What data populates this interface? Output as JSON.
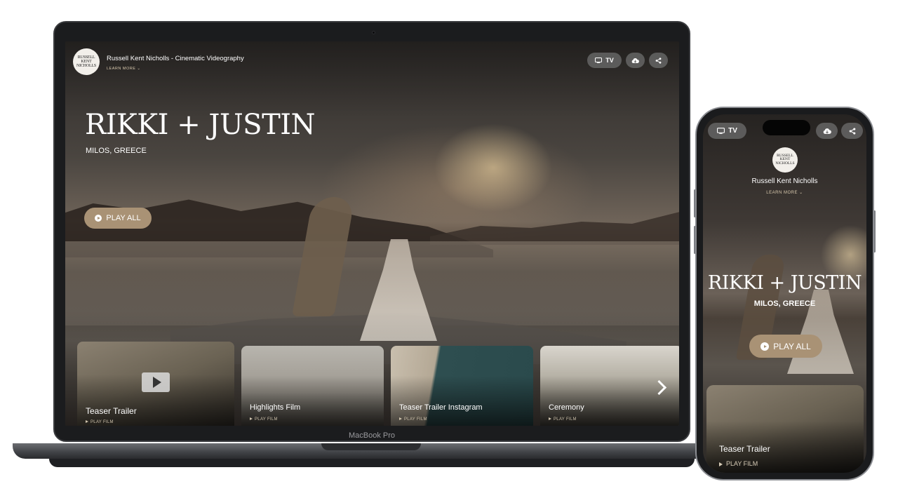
{
  "colors": {
    "accent": "#a99275",
    "learn_more": "#d8c9ad",
    "pill_bg": "rgba(110,110,110,0.75)",
    "device_frame": "#1b1c1e"
  },
  "laptop": {
    "device_label": "MacBook Pro",
    "header": {
      "logo_text": "RUSSELL\nKENT\nNICHOLLS",
      "brand_name": "Russell Kent Nicholls - Cinematic Videography",
      "learn_more": "LEARN MORE"
    },
    "top_buttons": {
      "tv_label": "TV",
      "tv_icon": "tv-icon",
      "download_icon": "cloud-download-icon",
      "share_icon": "share-icon"
    },
    "hero": {
      "title": "RIKKI + JUSTIN",
      "location": "MILOS, GREECE",
      "play_all_label": "PLAY ALL"
    },
    "films": [
      {
        "title": "Teaser Trailer",
        "action": "PLAY FILM"
      },
      {
        "title": "Highlights Film",
        "action": "PLAY FILM"
      },
      {
        "title": "Teaser Trailer Instagram",
        "action": "PLAY FILM"
      },
      {
        "title": "Ceremony",
        "action": "PLAY FILM"
      }
    ],
    "next_icon": "chevron-right-icon"
  },
  "phone": {
    "top_buttons": {
      "tv_label": "TV",
      "tv_icon": "tv-icon",
      "download_icon": "cloud-download-icon",
      "share_icon": "share-icon"
    },
    "header": {
      "logo_text": "RUSSELL\nKENT\nNICHOLLS",
      "brand_name": "Russell Kent Nicholls",
      "learn_more": "LEARN MORE"
    },
    "hero": {
      "title": "RIKKI + JUSTIN",
      "location": "MILOS, GREECE",
      "play_all_label": "PLAY ALL"
    },
    "film": {
      "title": "Teaser Trailer",
      "action": "PLAY FILM"
    }
  }
}
